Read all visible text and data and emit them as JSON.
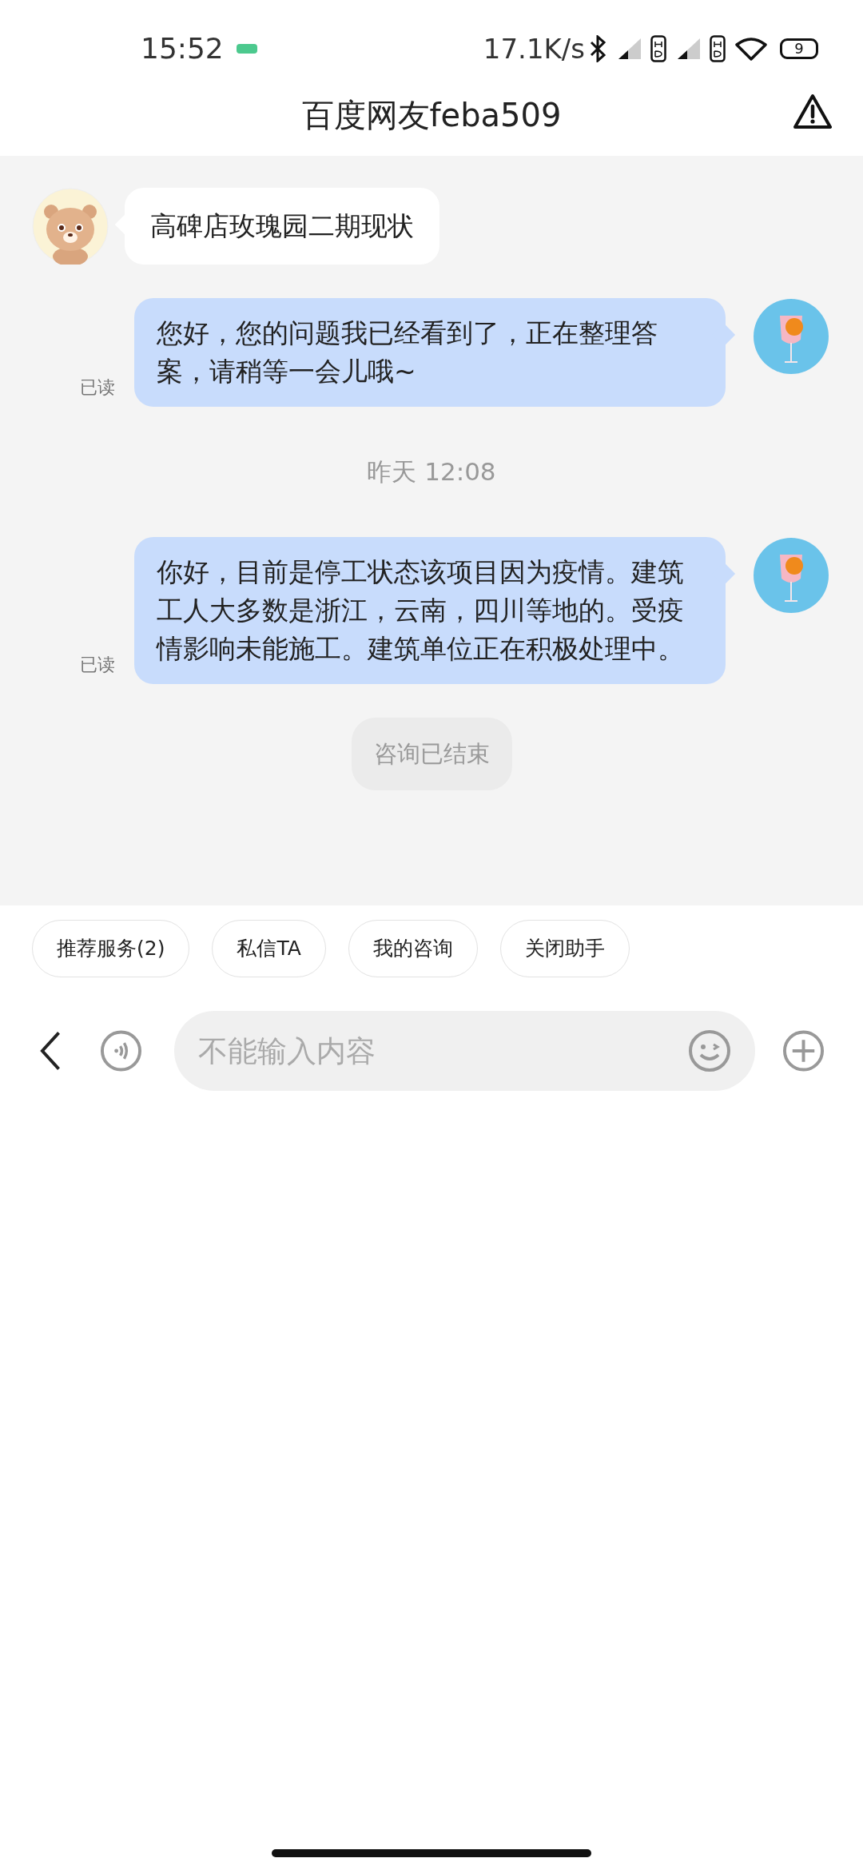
{
  "status_bar": {
    "time": "15:52",
    "net_speed": "17.1K/s",
    "battery": "9"
  },
  "header": {
    "title": "百度网友feba509"
  },
  "messages": [
    {
      "kind": "incoming",
      "text": "高碑店玫瑰园二期现状"
    },
    {
      "kind": "outgoing",
      "text": "您好，您的问题我已经看到了，正在整理答案，请稍等一会儿哦~",
      "receipt": "已读"
    },
    {
      "kind": "time",
      "text": "昨天 12:08"
    },
    {
      "kind": "outgoing",
      "text": "你好，目前是停工状态该项目因为疫情。建筑工人大多数是浙江，云南，四川等地的。受疫情影响未能施工。建筑单位正在积极处理中。",
      "receipt": "已读"
    },
    {
      "kind": "notice",
      "text": "咨询已结束"
    }
  ],
  "quick_actions": [
    "推荐服务(2)",
    "私信TA",
    "我的咨询",
    "关闭助手"
  ],
  "input": {
    "placeholder": "不能输入内容",
    "disabled": true
  }
}
